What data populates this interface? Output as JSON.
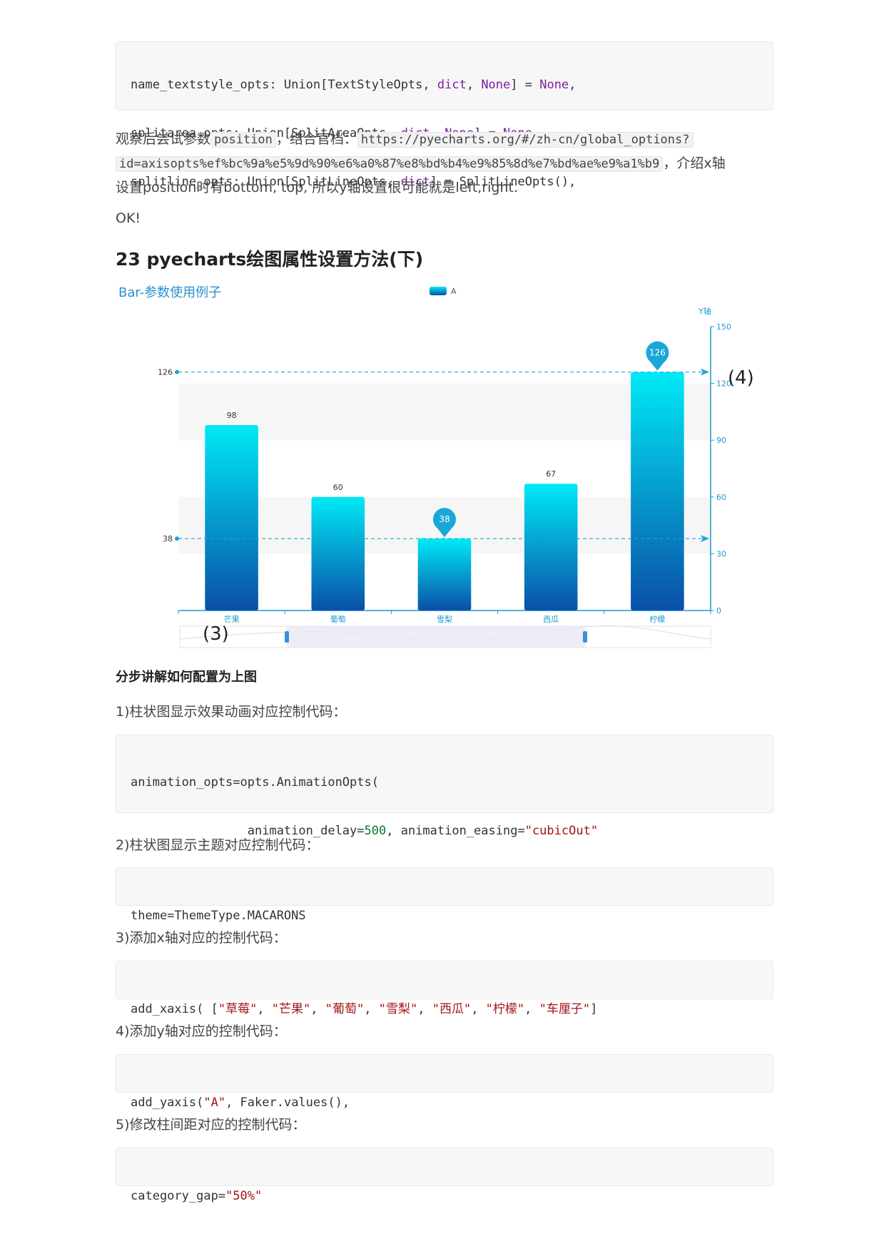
{
  "top_code": {
    "l1": {
      "a": "name_textstyle_opts: Union[TextStyleOpts, ",
      "b": "dict",
      "c": ", ",
      "d": "None",
      "e": "] = ",
      "f": "None",
      "g": ","
    },
    "l2": {
      "a": "splitarea_opts: Union[SplitAreaOpts, ",
      "b": "dict",
      "c": ", ",
      "d": "None",
      "e": "] = ",
      "f": "None",
      "g": ","
    },
    "l3": {
      "a": "splitline_opts: Union[SplitLineOpts, ",
      "b": "dict",
      "c": "] = SplitLineOpts(),"
    }
  },
  "para1": {
    "p1": "观察后尝试参数",
    "code1": "position",
    "p2": "，结合官档：",
    "code2": "https://pyecharts.org/#/zh-cn/global_options?",
    "code3": "id=axisopts%ef%bc%9a%e5%9d%90%e6%a0%87%e8%bd%b4%e9%85%8d%e7%bd%ae%e9%a1%b9",
    "p3": "，介绍x轴",
    "p4": "设置position时有bottom, top, 所以y轴设置很可能就是left,right."
  },
  "ok": "OK!",
  "heading": "23 pyecharts绘图属性设置方法(下)",
  "chart_data": {
    "type": "bar",
    "title": "Bar-参数使用例子",
    "legend": [
      "A"
    ],
    "legend_position": "top-center",
    "categories": [
      "芒果",
      "葡萄",
      "雪梨",
      "西瓜",
      "柠檬"
    ],
    "series": [
      {
        "name": "A",
        "values": [
          98,
          60,
          38,
          67,
          126
        ]
      }
    ],
    "ylabel": "Y轴",
    "y_axis_position": "right",
    "ylim": [
      0,
      150
    ],
    "y_ticks": [
      0,
      30,
      60,
      90,
      120,
      150
    ],
    "y_tick_labels": [
      "0",
      "30",
      "60",
      "90",
      "120",
      "150"
    ],
    "split_area": true,
    "mark_points": [
      {
        "category": "雪梨",
        "value": 38,
        "label": "38"
      },
      {
        "category": "柠檬",
        "value": 126,
        "label": "126"
      }
    ],
    "mark_lines": [
      {
        "value": 38,
        "label": "38"
      },
      {
        "value": 126,
        "label": "126"
      }
    ],
    "annotations": [
      "(3)",
      "(4)"
    ],
    "datazoom": true,
    "colors": {
      "bar_top": "#00eaf5",
      "bar_bottom": "#0a4fa8",
      "axis": "#1b9bd1",
      "title": "#2b8fd0",
      "marker": "#1aa6d9"
    }
  },
  "subheading": "分步讲解如何配置为上图",
  "step1": "1)柱状图显示效果动画对应控制代码：",
  "code1": {
    "l1": "animation_opts=opts.AnimationOpts(",
    "l2a": "                animation_delay=",
    "l2b": "500",
    "l2c": ", animation_easing=",
    "l2d": "\"cubicOut\"",
    "l3": "            )"
  },
  "step2": "2)柱状图显示主题对应控制代码：",
  "code2": "theme=ThemeType.MACARONS",
  "step3": "3)添加x轴对应的控制代码：",
  "code3": {
    "a": "add_xaxis( [",
    "items": [
      "\"草莓\"",
      "\"芒果\"",
      "\"葡萄\"",
      "\"雪梨\"",
      "\"西瓜\"",
      "\"柠檬\"",
      "\"车厘子\""
    ],
    "sep": ", ",
    "z": "]"
  },
  "step4": "4)添加y轴对应的控制代码：",
  "code4": {
    "a": "add_yaxis(",
    "b": "\"A\"",
    "c": ", Faker.values(),"
  },
  "step5": "5)修改柱间距对应的控制代码：",
  "code5": {
    "a": "category_gap=",
    "b": "\"50%\""
  }
}
